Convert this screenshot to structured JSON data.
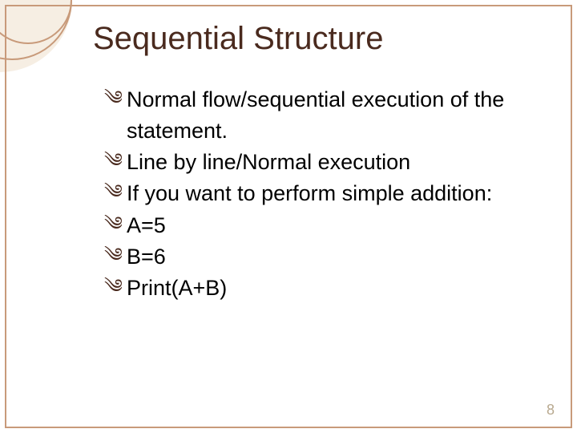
{
  "slide": {
    "title": "Sequential Structure",
    "bullets": [
      "Normal flow/sequential execution of the statement.",
      "Line by line/Normal execution",
      "If you want to perform simple addition:",
      "A=5",
      "B=6",
      "Print(A+B)"
    ],
    "bullet_glyph": "༄",
    "page_number": "8"
  }
}
